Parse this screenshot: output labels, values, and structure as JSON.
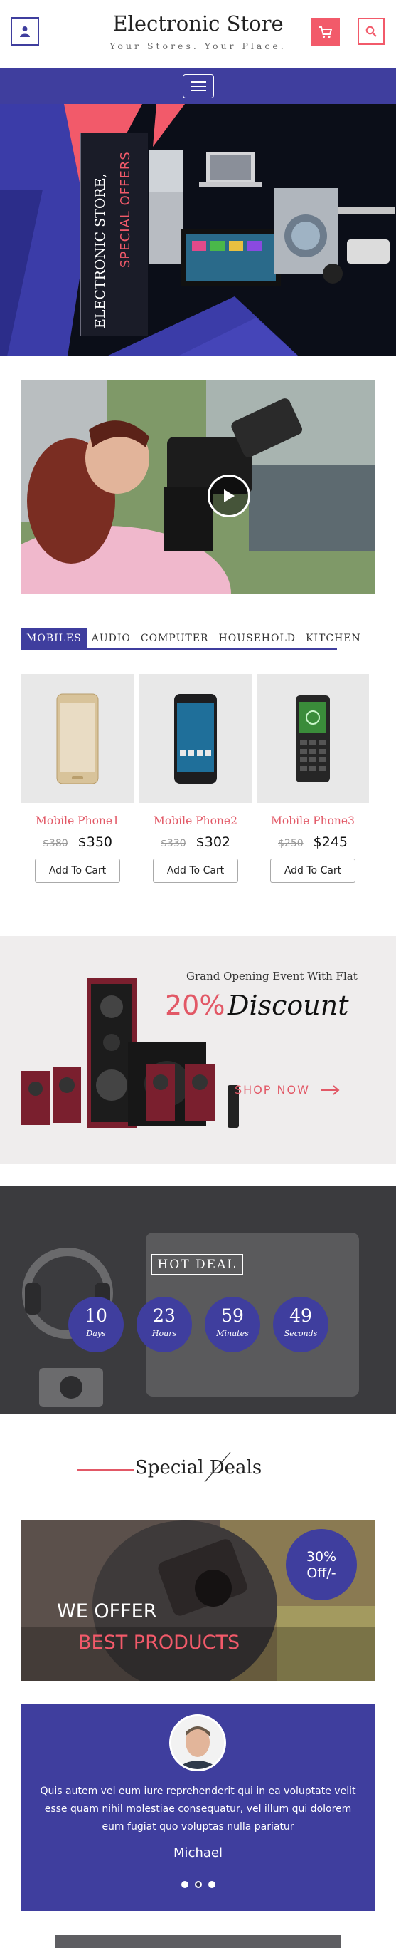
{
  "header": {
    "title": "Electronic Store",
    "tagline": "Your Stores. Your Place.",
    "icons": {
      "user": "user-icon",
      "cart": "cart-icon",
      "search": "search-icon",
      "menu": "hamburger-menu-icon"
    }
  },
  "hero": {
    "title": "ELECTRONIC STORE,",
    "subtitle": "SPECIAL OFFERS"
  },
  "video": {
    "play_icon": "play-icon"
  },
  "tabs": [
    {
      "label": "MOBILES",
      "active": true
    },
    {
      "label": "AUDIO",
      "active": false
    },
    {
      "label": "COMPUTER",
      "active": false
    },
    {
      "label": "HOUSEHOLD",
      "active": false
    },
    {
      "label": "KITCHEN",
      "active": false
    }
  ],
  "products": [
    {
      "name": "Mobile Phone1",
      "old_price": "$380",
      "price": "$350",
      "button": "Add To Cart"
    },
    {
      "name": "Mobile Phone2",
      "old_price": "$330",
      "price": "$302",
      "button": "Add To Cart"
    },
    {
      "name": "Mobile Phone3",
      "old_price": "$250",
      "price": "$245",
      "button": "Add To Cart"
    }
  ],
  "promo": {
    "kicker": "Grand Opening Event With Flat",
    "percent": "20%",
    "word": "Discount",
    "shop_now": "SHOP NOW"
  },
  "hot_deal": {
    "label": "HOT DEAL",
    "countdown": [
      {
        "value": "10",
        "unit": "Days"
      },
      {
        "value": "23",
        "unit": "Hours"
      },
      {
        "value": "59",
        "unit": "Minutes"
      },
      {
        "value": "49",
        "unit": "Seconds"
      }
    ]
  },
  "special_deals": {
    "title": "Special Deals",
    "badge_line1": "30%",
    "badge_line2": "Off/-",
    "line1": "WE OFFER",
    "line2": "BEST PRODUCTS"
  },
  "testimonial": {
    "quote": "Quis autem vel eum iure reprehenderit qui in ea voluptate velit esse quam nihil molestiae consequatur, vel illum qui dolorem eum fugiat quo voluptas nulla pariatur",
    "name": "Michael",
    "slides": 3,
    "active_slide": 2
  },
  "colors": {
    "primary": "#3f3e9e",
    "accent": "#f25a6a"
  }
}
